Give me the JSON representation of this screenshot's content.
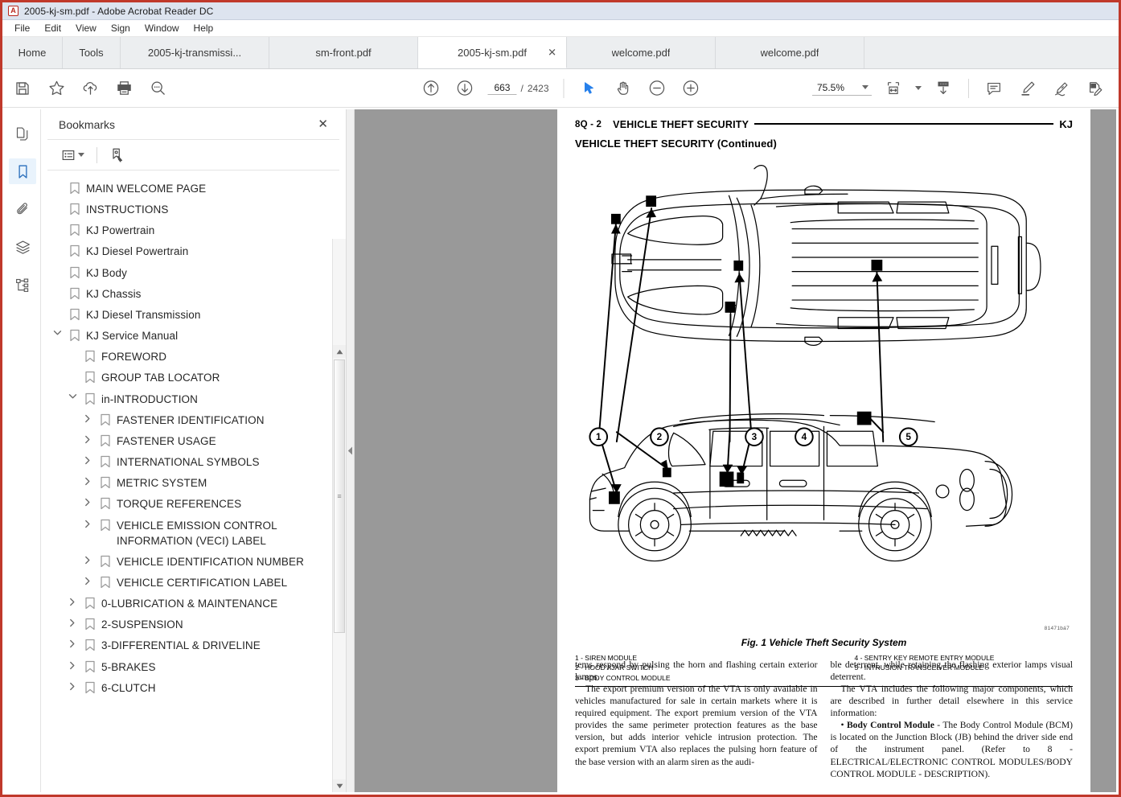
{
  "window": {
    "title": "2005-kj-sm.pdf - Adobe Acrobat Reader DC",
    "app_icon": "acrobat-icon",
    "accent_color": "#c0392b"
  },
  "menubar": {
    "items": [
      "File",
      "Edit",
      "View",
      "Sign",
      "Window",
      "Help"
    ]
  },
  "tabs": [
    {
      "label": "Home",
      "type": "home",
      "active": false
    },
    {
      "label": "Tools",
      "type": "tools",
      "active": false
    },
    {
      "label": "2005-kj-transmissi...",
      "type": "doc",
      "active": false
    },
    {
      "label": "sm-front.pdf",
      "type": "doc",
      "active": false
    },
    {
      "label": "2005-kj-sm.pdf",
      "type": "doc",
      "active": true,
      "close_label": "✕"
    },
    {
      "label": "welcome.pdf",
      "type": "doc",
      "active": false
    },
    {
      "label": "welcome.pdf",
      "type": "doc",
      "active": false
    }
  ],
  "toolbar": {
    "left_icons": [
      "save-icon",
      "star-icon",
      "upload-cloud-icon",
      "print-icon",
      "zoom-search-icon"
    ],
    "prev_page_icon": "arrow-up-circle-icon",
    "next_page_icon": "arrow-down-circle-icon",
    "page_current": "663",
    "page_separator": "/",
    "page_total": "2423",
    "select_tool_icon": "cursor-arrow-icon",
    "hand_tool_icon": "hand-icon",
    "zoom_out_icon": "minus-circle-icon",
    "zoom_in_icon": "plus-circle-icon",
    "zoom_value": "75.5%",
    "fit_page_icon": "fit-width-icon",
    "scroll_mode_icon": "page-display-icon",
    "comment_icon": "comment-icon",
    "highlight_icon": "highlighter-icon",
    "sign_icon": "sign-icon",
    "fill_sign_icon": "fill-and-sign-icon"
  },
  "navrail": {
    "items": [
      {
        "name": "page-thumbnails",
        "icon": "pages-icon",
        "active": false
      },
      {
        "name": "bookmarks",
        "icon": "bookmark-icon",
        "active": true
      },
      {
        "name": "attachments",
        "icon": "paperclip-icon",
        "active": false
      },
      {
        "name": "layers",
        "icon": "layers-icon",
        "active": false
      },
      {
        "name": "tags",
        "icon": "tags-tree-icon",
        "active": false
      }
    ]
  },
  "bookmarks_panel": {
    "title": "Bookmarks",
    "close_label": "✕",
    "options_icon": "list-options-icon",
    "options_caret": "chevron-down-icon",
    "new_bookmark_icon": "new-bookmark-icon",
    "scroll_up_icon": "scroll-up-arrow",
    "scroll_down_icon": "scroll-down-arrow",
    "items": [
      {
        "label": "MAIN WELCOME PAGE",
        "level": 0,
        "arrow": "none"
      },
      {
        "label": "INSTRUCTIONS",
        "level": 0,
        "arrow": "none"
      },
      {
        "label": "KJ Powertrain",
        "level": 0,
        "arrow": "none"
      },
      {
        "label": "KJ Diesel Powertrain",
        "level": 0,
        "arrow": "none"
      },
      {
        "label": "KJ Body",
        "level": 0,
        "arrow": "none"
      },
      {
        "label": "KJ Chassis",
        "level": 0,
        "arrow": "none"
      },
      {
        "label": "KJ Diesel Transmission",
        "level": 0,
        "arrow": "none"
      },
      {
        "label": "KJ Service Manual",
        "level": 0,
        "arrow": "down"
      },
      {
        "label": "FOREWORD",
        "level": 1,
        "arrow": "none"
      },
      {
        "label": "GROUP TAB LOCATOR",
        "level": 1,
        "arrow": "none"
      },
      {
        "label": "in-INTRODUCTION",
        "level": 1,
        "arrow": "down"
      },
      {
        "label": "FASTENER IDENTIFICATION",
        "level": 2,
        "arrow": "right"
      },
      {
        "label": "FASTENER USAGE",
        "level": 2,
        "arrow": "right"
      },
      {
        "label": "INTERNATIONAL SYMBOLS",
        "level": 2,
        "arrow": "right"
      },
      {
        "label": "METRIC SYSTEM",
        "level": 2,
        "arrow": "right"
      },
      {
        "label": "TORQUE REFERENCES",
        "level": 2,
        "arrow": "right"
      },
      {
        "label": "VEHICLE EMISSION CONTROL INFORMATION (VECI) LABEL",
        "level": 2,
        "arrow": "right"
      },
      {
        "label": "VEHICLE IDENTIFICATION NUMBER",
        "level": 2,
        "arrow": "right"
      },
      {
        "label": "VEHICLE CERTIFICATION LABEL",
        "level": 2,
        "arrow": "right"
      },
      {
        "label": "0-LUBRICATION & MAINTENANCE",
        "level": 1,
        "arrow": "right"
      },
      {
        "label": "2-SUSPENSION",
        "level": 1,
        "arrow": "right"
      },
      {
        "label": "3-DIFFERENTIAL & DRIVELINE",
        "level": 1,
        "arrow": "right"
      },
      {
        "label": "5-BRAKES",
        "level": 1,
        "arrow": "right"
      },
      {
        "label": "6-CLUTCH",
        "level": 1,
        "arrow": "right"
      }
    ]
  },
  "document": {
    "header_page_number": "8Q - 2",
    "header_title": "VEHICLE THEFT SECURITY",
    "header_right": "KJ",
    "subheading": "VEHICLE THEFT SECURITY (Continued)",
    "figure": {
      "caption": "Fig. 1 Vehicle Theft Security System",
      "art_code": "81471bá7",
      "callouts": [
        "1",
        "2",
        "3",
        "4",
        "5"
      ],
      "legend_left": [
        "1 - SIREN MODULE",
        "2 - HOOD AJAR SWITCH",
        "3 - BODY CONTROL MODULE"
      ],
      "legend_right": [
        "4 - SENTRY KEY REMOTE ENTRY MODULE",
        "5 - INTRUSION TRANSCEIVER MODULE"
      ]
    },
    "body": {
      "left_column": [
        "tems respond by pulsing the horn and flashing certain exterior lamps.",
        "The export premium version of the VTA is only available in vehicles manufactured for sale in certain markets where it is required equipment. The export premium version of the VTA provides the same perimeter protection features as the base version, but adds interior vehicle intrusion protection. The export premium VTA also replaces the pulsing horn feature of the base version with an alarm siren as the audi-"
      ],
      "right_column_1": "ble deterrent, while retaining the flashing exterior lamps visual deterrent.",
      "right_column_2": "The VTA includes the following major components, which are described in further detail elsewhere in this service information:",
      "right_bullet_bold": "Body Control Module",
      "right_bullet_rest": " - The Body Control Module (BCM) is located on the Junction Block (JB) behind the driver side end of the instrument panel. (Refer to 8 - ELECTRICAL/ELECTRONIC CONTROL MODULES/BODY CONTROL MODULE - DESCRIPTION)."
    }
  }
}
